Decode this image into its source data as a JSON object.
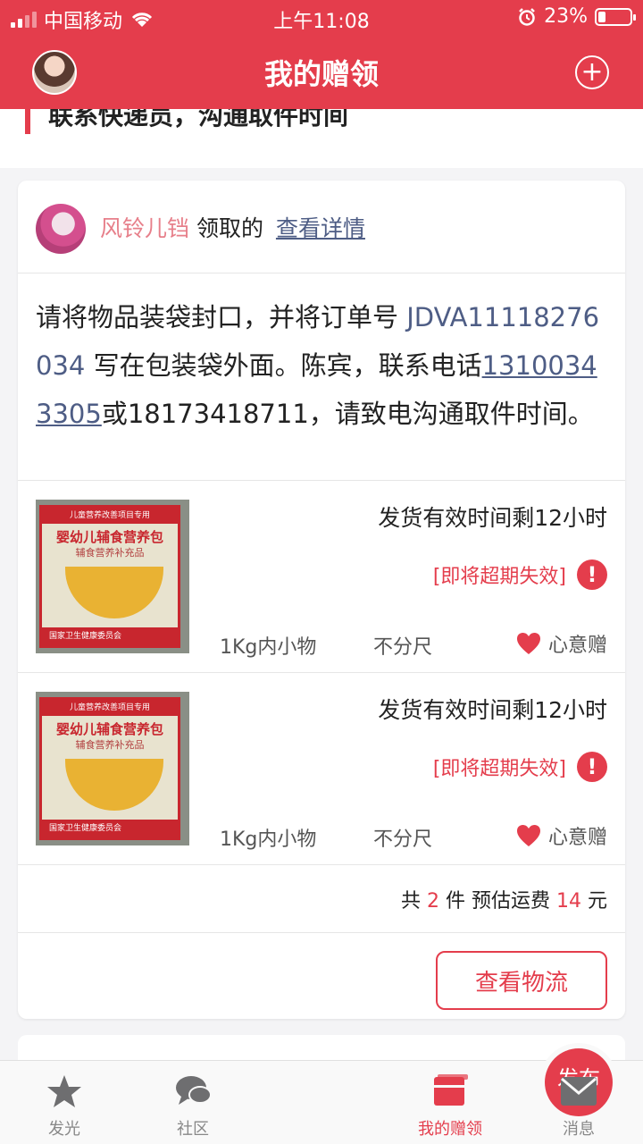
{
  "status_bar": {
    "carrier": "中国移动",
    "time": "上午11:08",
    "battery": "23%",
    "battery_level": 0.23
  },
  "header": {
    "title": "我的赠领"
  },
  "prev_card": {
    "snippet": "联系快递员，沟通取件时间"
  },
  "card": {
    "user_name": "风铃儿铛",
    "action_text": "领取的",
    "detail_link": "查看详情",
    "notice": {
      "part1": "请将物品装袋封口，并将订单号 ",
      "order_no": "JDVA11118276034",
      "part2": " 写在包装袋外面。陈宾，联系电话",
      "phone1": "13100343305",
      "part3": "或18173418711，请致电沟通取件时间。"
    },
    "items": [
      {
        "remaining": "发货有效时间剩12小时",
        "expire": "[即将超期失效]",
        "size": "1Kg内小物",
        "fit": "不分尺",
        "type": "心意赠",
        "product": {
          "band_top": "儿童营养改善项目专用",
          "title": "婴幼儿辅食营养包",
          "subtitle": "辅食营养补充品",
          "band_bottom": "国家卫生健康委员会"
        }
      },
      {
        "remaining": "发货有效时间剩12小时",
        "expire": "[即将超期失效]",
        "size": "1Kg内小物",
        "fit": "不分尺",
        "type": "心意赠",
        "product": {
          "band_top": "儿童营养改善项目专用",
          "title": "婴幼儿辅食营养包",
          "subtitle": "辅食营养补充品",
          "band_bottom": "国家卫生健康委员会"
        }
      }
    ],
    "summary": {
      "prefix": "共",
      "count": "2",
      "middle": "件 预估运费",
      "fee": "14",
      "suffix": "元"
    },
    "logistics_button": "查看物流"
  },
  "tabbar": {
    "tabs": [
      {
        "label": "发光"
      },
      {
        "label": "社区"
      },
      {
        "label": "发布"
      },
      {
        "label": "我的赠领"
      },
      {
        "label": "消息"
      }
    ],
    "active_color": "#e43d4c"
  },
  "colors": {
    "brand": "#e43d4c",
    "link": "#4e5d85"
  }
}
